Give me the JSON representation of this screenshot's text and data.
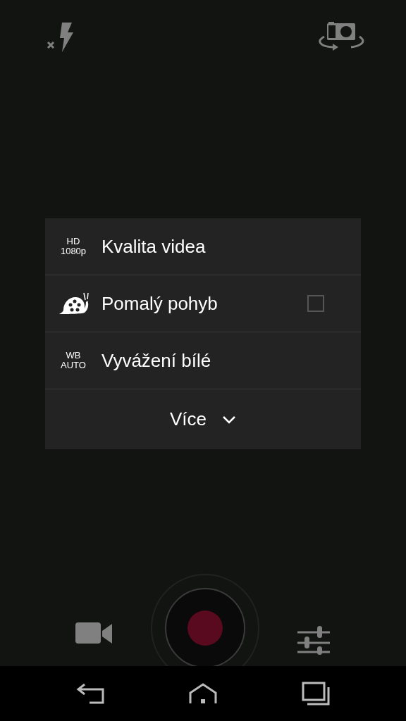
{
  "menu": {
    "items": [
      {
        "kind": "badge",
        "badge": [
          "HD",
          "1080p"
        ],
        "label": "Kvalita videa"
      },
      {
        "kind": "snail",
        "label": "Pomalý pohyb",
        "checked": false
      },
      {
        "kind": "badge",
        "badge": [
          "WB",
          "AUTO"
        ],
        "label": "Vyvážení bílé"
      }
    ],
    "more": {
      "label": "Více"
    }
  }
}
